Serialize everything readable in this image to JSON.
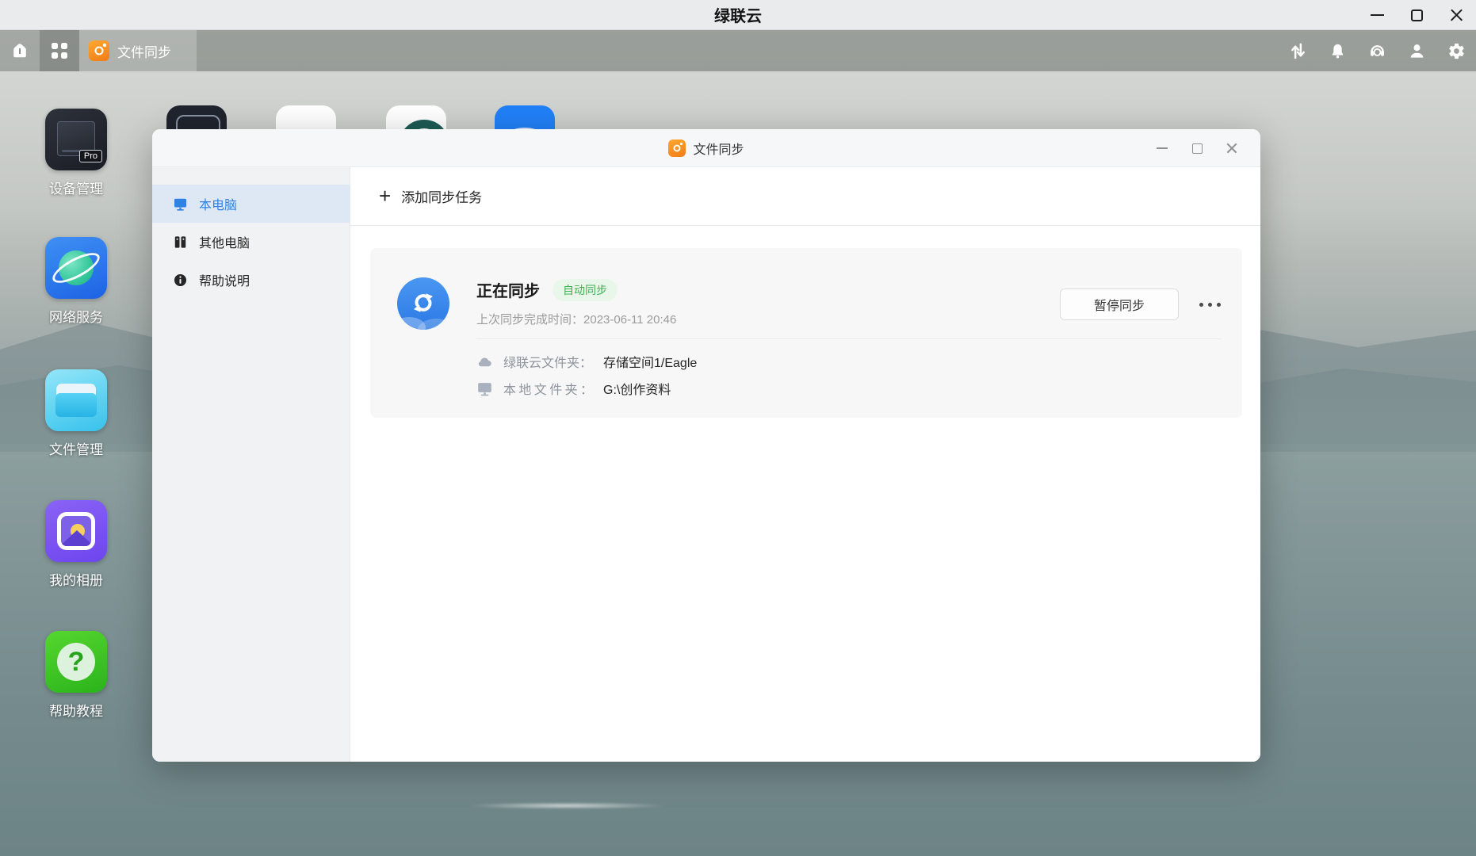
{
  "window": {
    "title": "绿联云"
  },
  "tabbar": {
    "active_tab": "文件同步",
    "right_icons": [
      "transfer-icon",
      "bell-icon",
      "headset-icon",
      "user-icon",
      "gear-icon"
    ]
  },
  "desktop": {
    "icons": [
      {
        "label": "设备管理",
        "badge": "Pro"
      },
      {
        "label": "网络服务"
      },
      {
        "label": "文件管理"
      },
      {
        "label": "我的相册"
      },
      {
        "label": "帮助教程"
      }
    ]
  },
  "dialog": {
    "title": "文件同步",
    "sidebar": {
      "items": [
        {
          "label": "本电脑",
          "active": true
        },
        {
          "label": "其他电脑",
          "active": false
        },
        {
          "label": "帮助说明",
          "active": false
        }
      ]
    },
    "add_task_label": "添加同步任务",
    "task": {
      "status_title": "正在同步",
      "badge": "自动同步",
      "last_sync_label": "上次同步完成时间：",
      "last_sync_value": "2023-06-11 20:46",
      "cloud_folder_label": "绿联云文件夹：",
      "cloud_folder_value": "存储空间1/Eagle",
      "local_folder_label": "本地文件夹：",
      "local_folder_value": "G:\\创作资料",
      "pause_button": "暂停同步"
    }
  },
  "icons": {
    "plus": "+",
    "question_mark": "?"
  },
  "colors": {
    "accent_blue": "#2d82e4",
    "badge_green": "#3db054",
    "badge_green_bg": "#e9f7eb",
    "app_orange": "#f7941e",
    "sidebar_active_bg": "#dde8f4"
  }
}
